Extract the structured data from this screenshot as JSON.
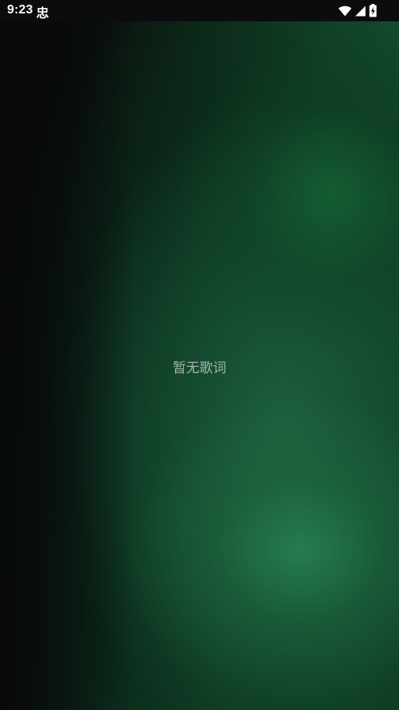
{
  "status_bar": {
    "time": "9:23",
    "app_icon_glyph": "忠",
    "icons": [
      "wifi-icon",
      "cellular-signal-icon",
      "battery-charging-icon"
    ]
  },
  "lyrics": {
    "empty_message": "暂无歌词"
  },
  "colors": {
    "background_dark": "#08090b",
    "background_green": "#145232",
    "glow_green": "#267d50",
    "message_text": "#a8b3ad"
  }
}
